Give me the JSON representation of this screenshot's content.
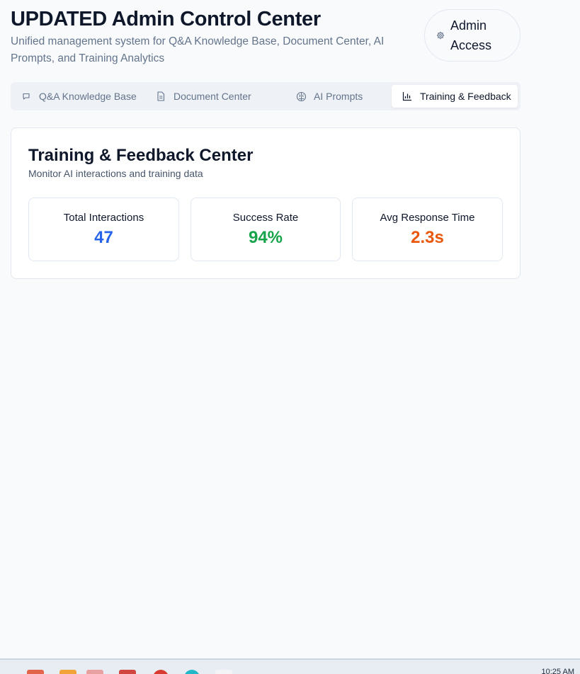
{
  "header": {
    "title": "UPDATED Admin Control Center",
    "subtitle": "Unified management system for Q&A Knowledge Base, Document Center, AI Prompts, and Training Analytics",
    "admin_badge": "Admin Access",
    "admin_icon": "settings-icon"
  },
  "tabs": [
    {
      "label": "Q&A Knowledge Base",
      "icon": "message-square-icon",
      "active": false
    },
    {
      "label": "Document Center",
      "icon": "file-text-icon",
      "active": false
    },
    {
      "label": "AI Prompts",
      "icon": "brain-icon",
      "active": false
    },
    {
      "label": "Training & Feedback",
      "icon": "bar-chart-icon",
      "active": true
    }
  ],
  "training": {
    "title": "Training & Feedback Center",
    "subtitle": "Monitor AI interactions and training data",
    "stats": [
      {
        "label": "Total Interactions",
        "value": "47",
        "color": "#2563eb"
      },
      {
        "label": "Success Rate",
        "value": "94%",
        "color": "#16a34a"
      },
      {
        "label": "Avg Response Time",
        "value": "2.3s",
        "color": "#ea580c"
      }
    ]
  },
  "taskbar": {
    "clock": "10:25 AM"
  }
}
